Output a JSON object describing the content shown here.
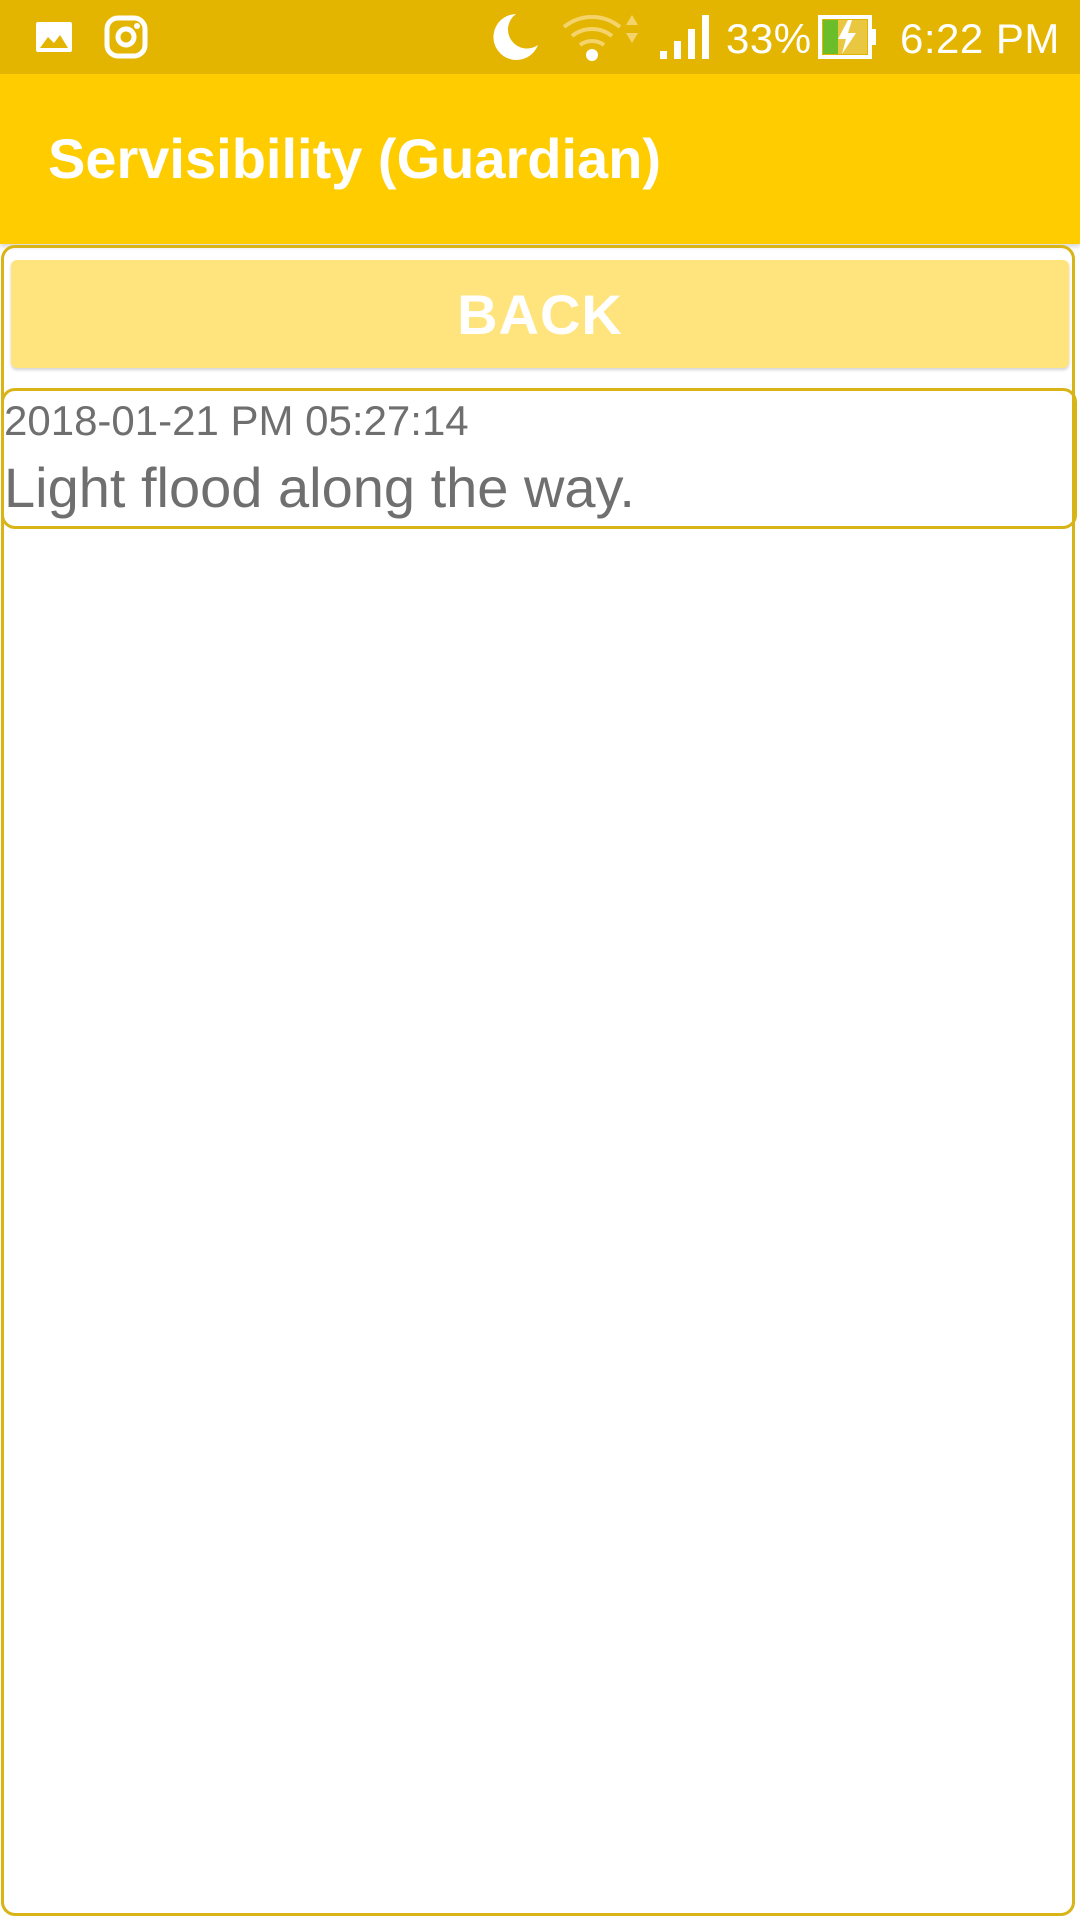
{
  "status_bar": {
    "battery_percent": "33%",
    "time": "6:22 PM",
    "icons": [
      "gallery-icon",
      "instagram-icon",
      "moon-icon",
      "wifi-icon",
      "signal-icon",
      "battery-charging-icon"
    ],
    "battery_level": 0.33
  },
  "app_bar": {
    "title": "Servisibility (Guardian)"
  },
  "back_button": {
    "label": "BACK"
  },
  "list": {
    "items": [
      {
        "timestamp": "2018-01-21 PM 05:27:14",
        "message": "Light flood along the way."
      }
    ]
  },
  "colors": {
    "status_bar": "#E3B500",
    "app_bar": "#FFCC00",
    "button": "#FFE47E",
    "border": "#D8B416",
    "text_gray": "#6F6F6F"
  }
}
